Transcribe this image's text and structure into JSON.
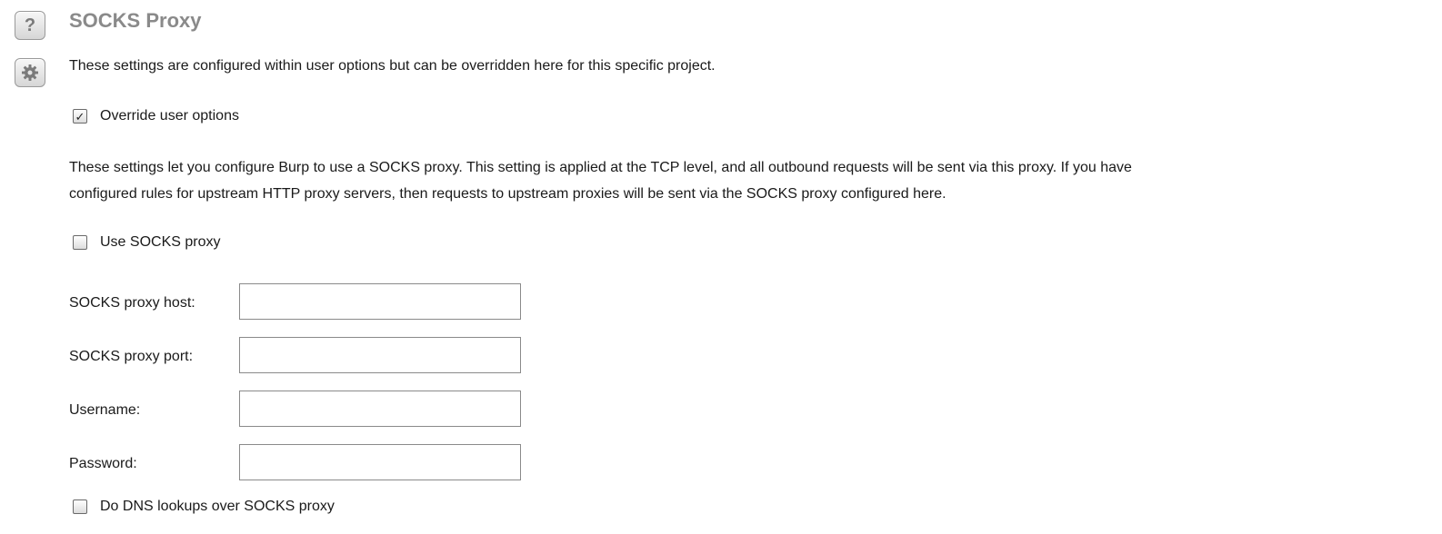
{
  "section": {
    "title": "SOCKS Proxy",
    "help_icon": "help-icon",
    "settings_icon": "gear-icon",
    "help_glyph": "?",
    "intro_text": "These settings are configured within user options but can be overridden here for this specific project."
  },
  "override": {
    "label": "Override user options",
    "checked": true,
    "check_glyph": "✓"
  },
  "description": {
    "line1": "These settings let you configure Burp to use a SOCKS proxy. This setting is applied at the TCP level, and all outbound requests will be sent via this proxy. If you have",
    "line2": "configured rules for upstream HTTP proxy servers, then requests to upstream proxies will be sent via the SOCKS proxy configured here."
  },
  "use_socks": {
    "label": "Use SOCKS proxy",
    "checked": false
  },
  "fields": {
    "host": {
      "label": "SOCKS proxy host:",
      "value": ""
    },
    "port": {
      "label": "SOCKS proxy port:",
      "value": ""
    },
    "username": {
      "label": "Username:",
      "value": ""
    },
    "password": {
      "label": "Password:",
      "value": ""
    }
  },
  "dns": {
    "label": "Do DNS lookups over SOCKS proxy",
    "checked": false
  }
}
